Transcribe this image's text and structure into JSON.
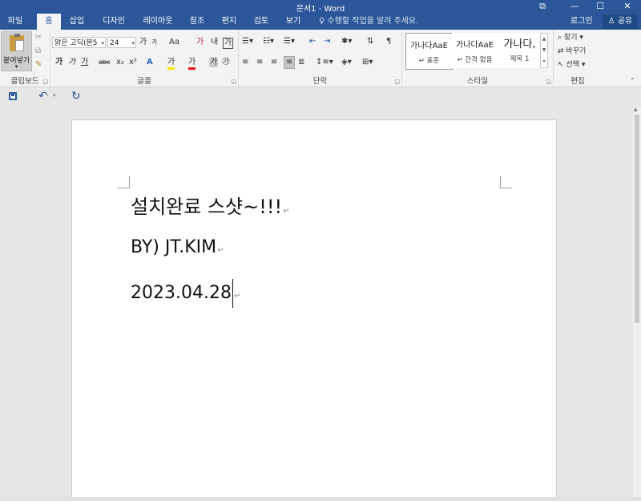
{
  "window": {
    "title": "문서1 - Word",
    "controls": [
      "⧉",
      "—",
      "☐",
      "✕"
    ]
  },
  "tabs": [
    {
      "label": "파일",
      "active": false
    },
    {
      "label": "홈",
      "active": true
    },
    {
      "label": "삽입",
      "active": false
    },
    {
      "label": "디자인",
      "active": false
    },
    {
      "label": "레이아웃",
      "active": false
    },
    {
      "label": "참조",
      "active": false
    },
    {
      "label": "편지",
      "active": false
    },
    {
      "label": "검토",
      "active": false
    },
    {
      "label": "보기",
      "active": false
    }
  ],
  "tell_me": "♀ 수행할 작업을 알려 주세요.",
  "account": {
    "login": "로그인",
    "share": "♙ 공유"
  },
  "ribbon": {
    "clipboard": {
      "label": "클립보드",
      "paste": "붙여넣기"
    },
    "font": {
      "label": "글꼴",
      "font_name": "맑은 고딕(본5",
      "font_size": "24",
      "buttons_row1": [
        "가",
        "가",
        "Aa",
        "가",
        "내",
        "가"
      ],
      "buttons_row2": [
        "가",
        "가",
        "가",
        "abc",
        "x₂",
        "x²",
        "A",
        "가",
        "가",
        "가",
        "㉮"
      ]
    },
    "paragraph": {
      "label": "단락"
    },
    "styles": {
      "label": "스타일",
      "items": [
        {
          "sample": "가나다AaE",
          "name": "↵ 표준"
        },
        {
          "sample": "가나다AaE",
          "name": "↵ 간격 없음"
        },
        {
          "sample": "가나다,",
          "name": "제목 1"
        }
      ]
    },
    "editing": {
      "label": "편집",
      "find": "찾기",
      "replace": "바꾸기",
      "select": "선택"
    }
  },
  "document": {
    "lines": [
      {
        "text": "설치완료  스샷~!!!",
        "mark": "↵"
      },
      {
        "text": "BY) JT.KIM",
        "mark": "↵"
      },
      {
        "text": "2023.04.28",
        "mark": "↵"
      }
    ]
  },
  "colors": {
    "accent": "#2b579a",
    "ribbon_bg": "#f3f3f3",
    "canvas_bg": "#e6e6e6"
  }
}
